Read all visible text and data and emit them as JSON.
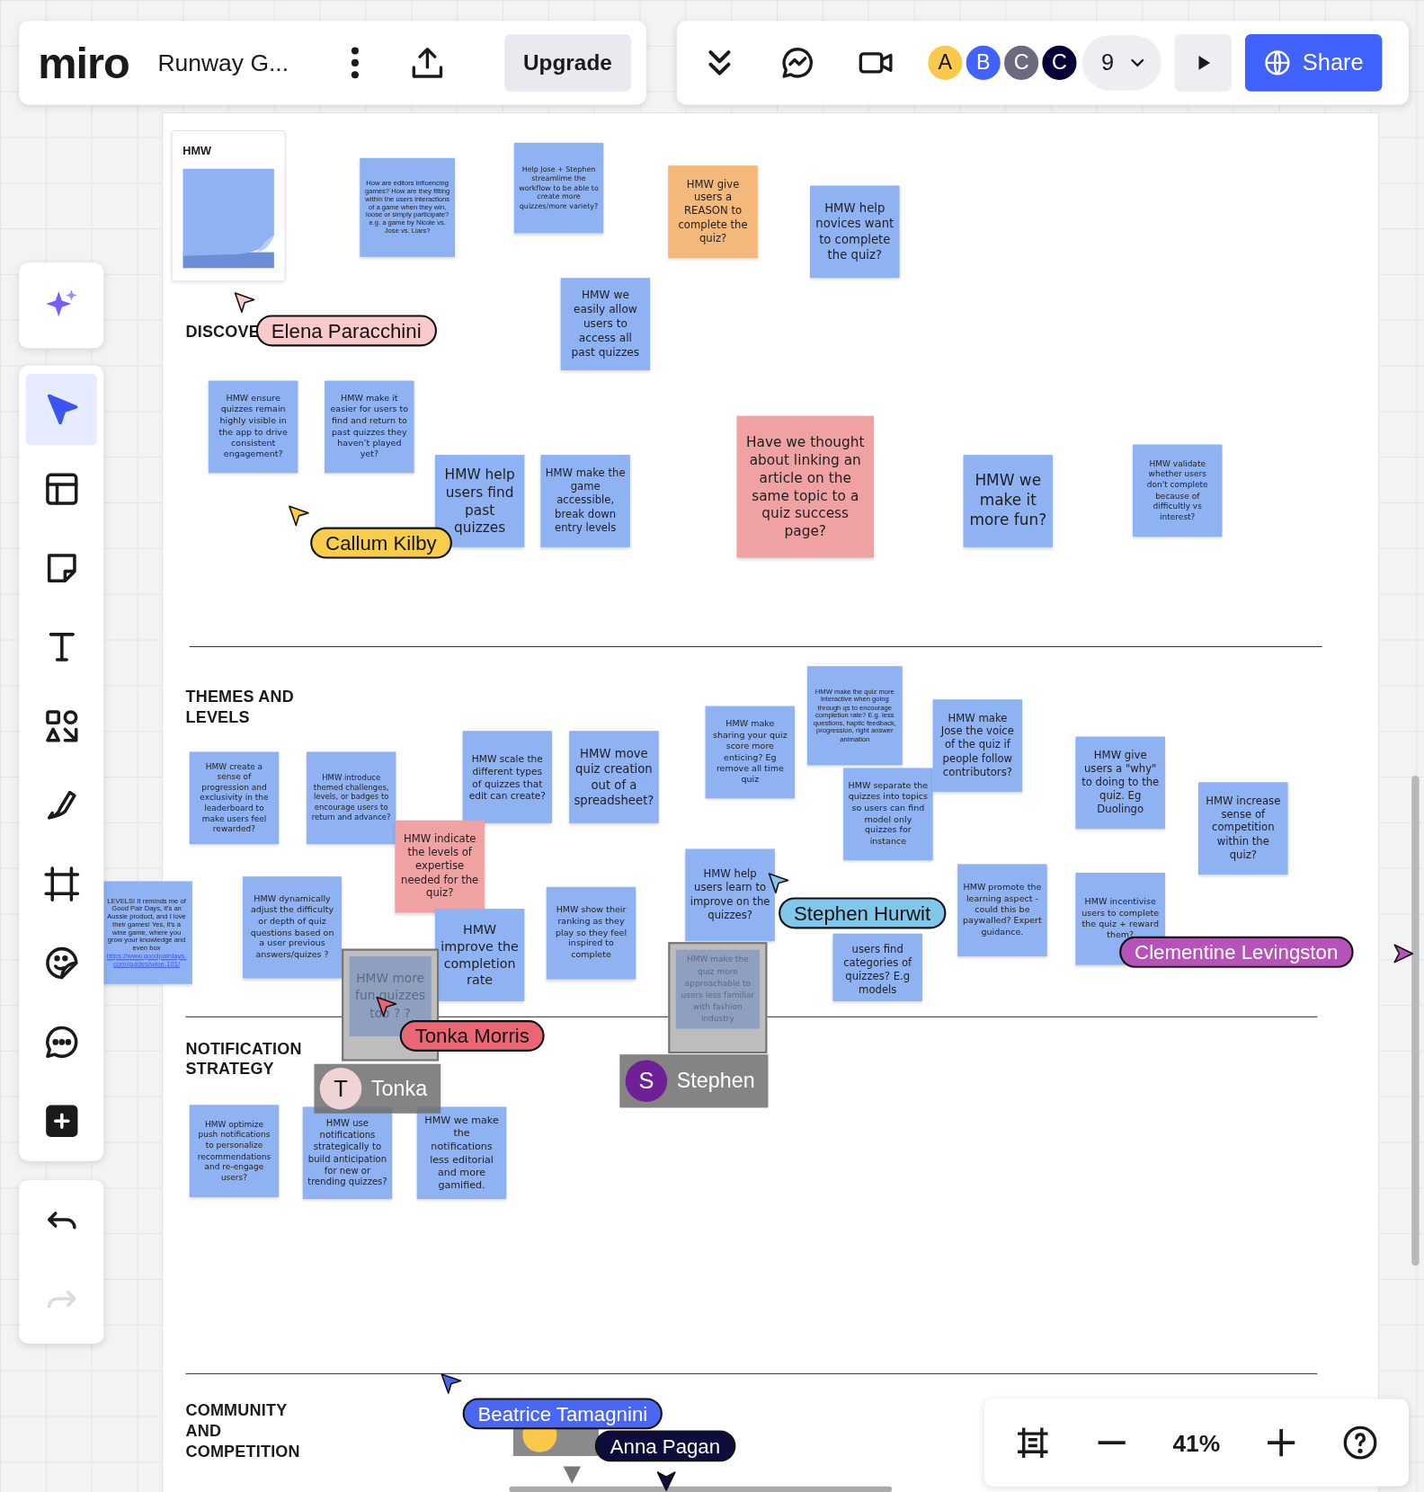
{
  "board": {
    "logo": "miro",
    "title": "Runway G...",
    "upgrade_label": "Upgrade",
    "share_label": "Share",
    "collaborator_count": "9",
    "zoom": "41%",
    "frame_label": "HMW"
  },
  "collaborators": [
    {
      "initial": "A",
      "color": "#fac84a"
    },
    {
      "initial": "B",
      "color": "#4262ff"
    },
    {
      "initial": "C",
      "color": "#6b6b80"
    },
    {
      "initial": "C",
      "color": "#050038"
    }
  ],
  "tools": [
    {
      "kind": "magic",
      "selected": false,
      "disabled": false
    },
    {
      "kind": "select",
      "selected": true,
      "disabled": false
    },
    {
      "kind": "templates",
      "selected": false,
      "disabled": false
    },
    {
      "kind": "sticky",
      "selected": false,
      "disabled": false
    },
    {
      "kind": "text",
      "selected": false,
      "disabled": false
    },
    {
      "kind": "shapes",
      "selected": false,
      "disabled": false
    },
    {
      "kind": "pen",
      "selected": false,
      "disabled": false
    },
    {
      "kind": "frame",
      "selected": false,
      "disabled": false
    },
    {
      "kind": "sticker",
      "selected": false,
      "disabled": false
    },
    {
      "kind": "comment",
      "selected": false,
      "disabled": false
    },
    {
      "kind": "add",
      "selected": false,
      "disabled": false
    },
    {
      "kind": "undo",
      "selected": false,
      "disabled": false
    },
    {
      "kind": "redo",
      "selected": false,
      "disabled": true
    }
  ],
  "sections": [
    {
      "heading": "DISCOVE"
    },
    {
      "heading": "THEMES AND LEVELS"
    },
    {
      "heading": "NOTIFICATION STRATEGY"
    },
    {
      "heading": "COMMUNITY AND COMPETITION"
    }
  ],
  "stickies": [
    {
      "kind": "note",
      "color": "#8fb2f3",
      "text": "How are editors influencing games? How are they fitting within the users interactions of a game when they win, loose or simply participate? e.g. a game by Nicole vs. Jose vs. Liars?"
    },
    {
      "kind": "note",
      "color": "#8fb2f3",
      "text": "Help Jose + Stephen streamlime the workflow to be able to create more quizzes/more variety?"
    },
    {
      "kind": "note",
      "color": "#f4b87a",
      "text": "HMW give users a REASON to complete the quiz?"
    },
    {
      "kind": "note",
      "color": "#8fb2f3",
      "text": "HMW help novices want to complete the quiz?"
    },
    {
      "kind": "note",
      "color": "#8fb2f3",
      "text": "HMW we easily allow users to access all past quizzes"
    },
    {
      "kind": "note",
      "color": "#8fb2f3",
      "text": "HMW ensure quizzes remain highly visible in the app to drive consistent engagement?"
    },
    {
      "kind": "note",
      "color": "#8fb2f3",
      "text": "HMW make it easier for users to find and return to past quizzes they haven’t played yet?"
    },
    {
      "kind": "note",
      "color": "#8fb2f3",
      "text": "HMW help users find past quizzes"
    },
    {
      "kind": "note",
      "color": "#8fb2f3",
      "text": "HMW make the game accessible, break down entry levels"
    },
    {
      "kind": "note",
      "color": "#f0a2a2",
      "text": "Have we thought about linking an article on the same topic to a quiz success page?"
    },
    {
      "kind": "note",
      "color": "#8fb2f3",
      "text": "HMW we make it more fun?"
    },
    {
      "kind": "note",
      "color": "#8fb2f3",
      "text": "HMW validate whether users don't complete because of difficultly vs interest?"
    },
    {
      "kind": "note",
      "color": "#8fb2f3",
      "text": "HMW create a sense of progression and exclusivity in the leaderboard to make users feel rewarded?"
    },
    {
      "kind": "note",
      "color": "#8fb2f3",
      "text": "HMW introduce themed challenges, levels, or badges to encourage users to return and advance?"
    },
    {
      "kind": "note",
      "color": "#8fb2f3",
      "text": "HMW scale the different types of quizzes that edit can create?"
    },
    {
      "kind": "note",
      "color": "#8fb2f3",
      "text": "HMW move quiz creation out of a spreadsheet?"
    },
    {
      "kind": "note",
      "color": "#f0a2a2",
      "text": "HMW indicate the levels of expertise needed for the quiz?"
    },
    {
      "kind": "note",
      "color": "#8fb2f3",
      "text": "HMW make sharing your quiz score more enticing? Eg remove all time quiz"
    },
    {
      "kind": "note",
      "color": "#8fb2f3",
      "text": "HMW make the quiz more interactive when going through qs to encourage completion rate? E.g. less questions, haptic feedback, progression, right answer animation"
    },
    {
      "kind": "note",
      "color": "#8fb2f3",
      "text": "HMW separate the quizzes into topics so users can find model only quizzes for instance"
    },
    {
      "kind": "note",
      "color": "#8fb2f3",
      "text": "HMW make Jose the voice of the quiz if people follow contributors?"
    },
    {
      "kind": "note",
      "color": "#8fb2f3",
      "text": "HMW give users a \"why\" to doing to the quiz. Eg Duolingo"
    },
    {
      "kind": "note",
      "color": "#8fb2f3",
      "text": "HMW increase sense of competition within the quiz?"
    },
    {
      "kind": "note",
      "color": "#8fb2f3",
      "text": "LEVELS! It reminds me of Good Pair Days, it's an Aussie product, and I love their games! Yes, it's a wine game, where you grow your knowledge and even box",
      "link": "https://www.goodpairdays.com/guides/wine-101/"
    },
    {
      "kind": "note",
      "color": "#8fb2f3",
      "text": "HMW dynamically adjust the difficulty or depth of quiz questions based on a user  previous answers/quizes ?"
    },
    {
      "kind": "note",
      "color": "#8fb2f3",
      "text": "HMW improve the completion rate"
    },
    {
      "kind": "note",
      "color": "#8fb2f3",
      "text": "HMW show their ranking as they play so they feel inspired to complete"
    },
    {
      "kind": "note",
      "color": "#8fb2f3",
      "text": "HMW help users learn to improve on the quizzes?"
    },
    {
      "kind": "note",
      "color": "#8fb2f3",
      "text": "users find categories of quizzes? E.g models"
    },
    {
      "kind": "note",
      "color": "#8fb2f3",
      "text": "HMW promote the learning aspect - could this be paywalled? Expert guidance."
    },
    {
      "kind": "note",
      "color": "#8fb2f3",
      "text": "HMW incentivise users to complete the quiz + reward them?"
    },
    {
      "kind": "ghost",
      "color": "#8e9fc0",
      "text": "HMW more fun quizzes too ? ?"
    },
    {
      "kind": "ghost",
      "color": "#8e9fc0",
      "text": "HMW make the quiz more approachable to users less familiar with fashion industry"
    },
    {
      "kind": "note",
      "color": "#8fb2f3",
      "text": "HMW optimize push notifications to personalize recommendations and re-engage users?"
    },
    {
      "kind": "note",
      "color": "#8fb2f3",
      "text": "HMW use notifications strategically to build anticipation for new or trending quizzes?"
    },
    {
      "kind": "note",
      "color": "#8fb2f3",
      "text": "HMW we make the notifications less editorial and more gamified."
    }
  ],
  "cursors": [
    {
      "name": "Elena Paracchini",
      "color": "#f9c9cc"
    },
    {
      "name": "Callum Kilby",
      "color": "#f7cd4a"
    },
    {
      "name": "Stephen Hurwit",
      "color": "#80c7ea"
    },
    {
      "name": "Clementine Levingston",
      "color": "#b653b8"
    },
    {
      "name": "Tonka Morris",
      "color": "#ea6673"
    },
    {
      "name": "Beatrice Tamagnini",
      "color": "#4a66f5"
    },
    {
      "name": "Anna Pagan",
      "color": "#0e0b3d"
    }
  ],
  "drag_chips": [
    {
      "name": "Tonka",
      "initial": "T",
      "color": "#f0d3d3"
    },
    {
      "name": "Stephen",
      "initial": "S",
      "color": "#6e2196"
    }
  ]
}
